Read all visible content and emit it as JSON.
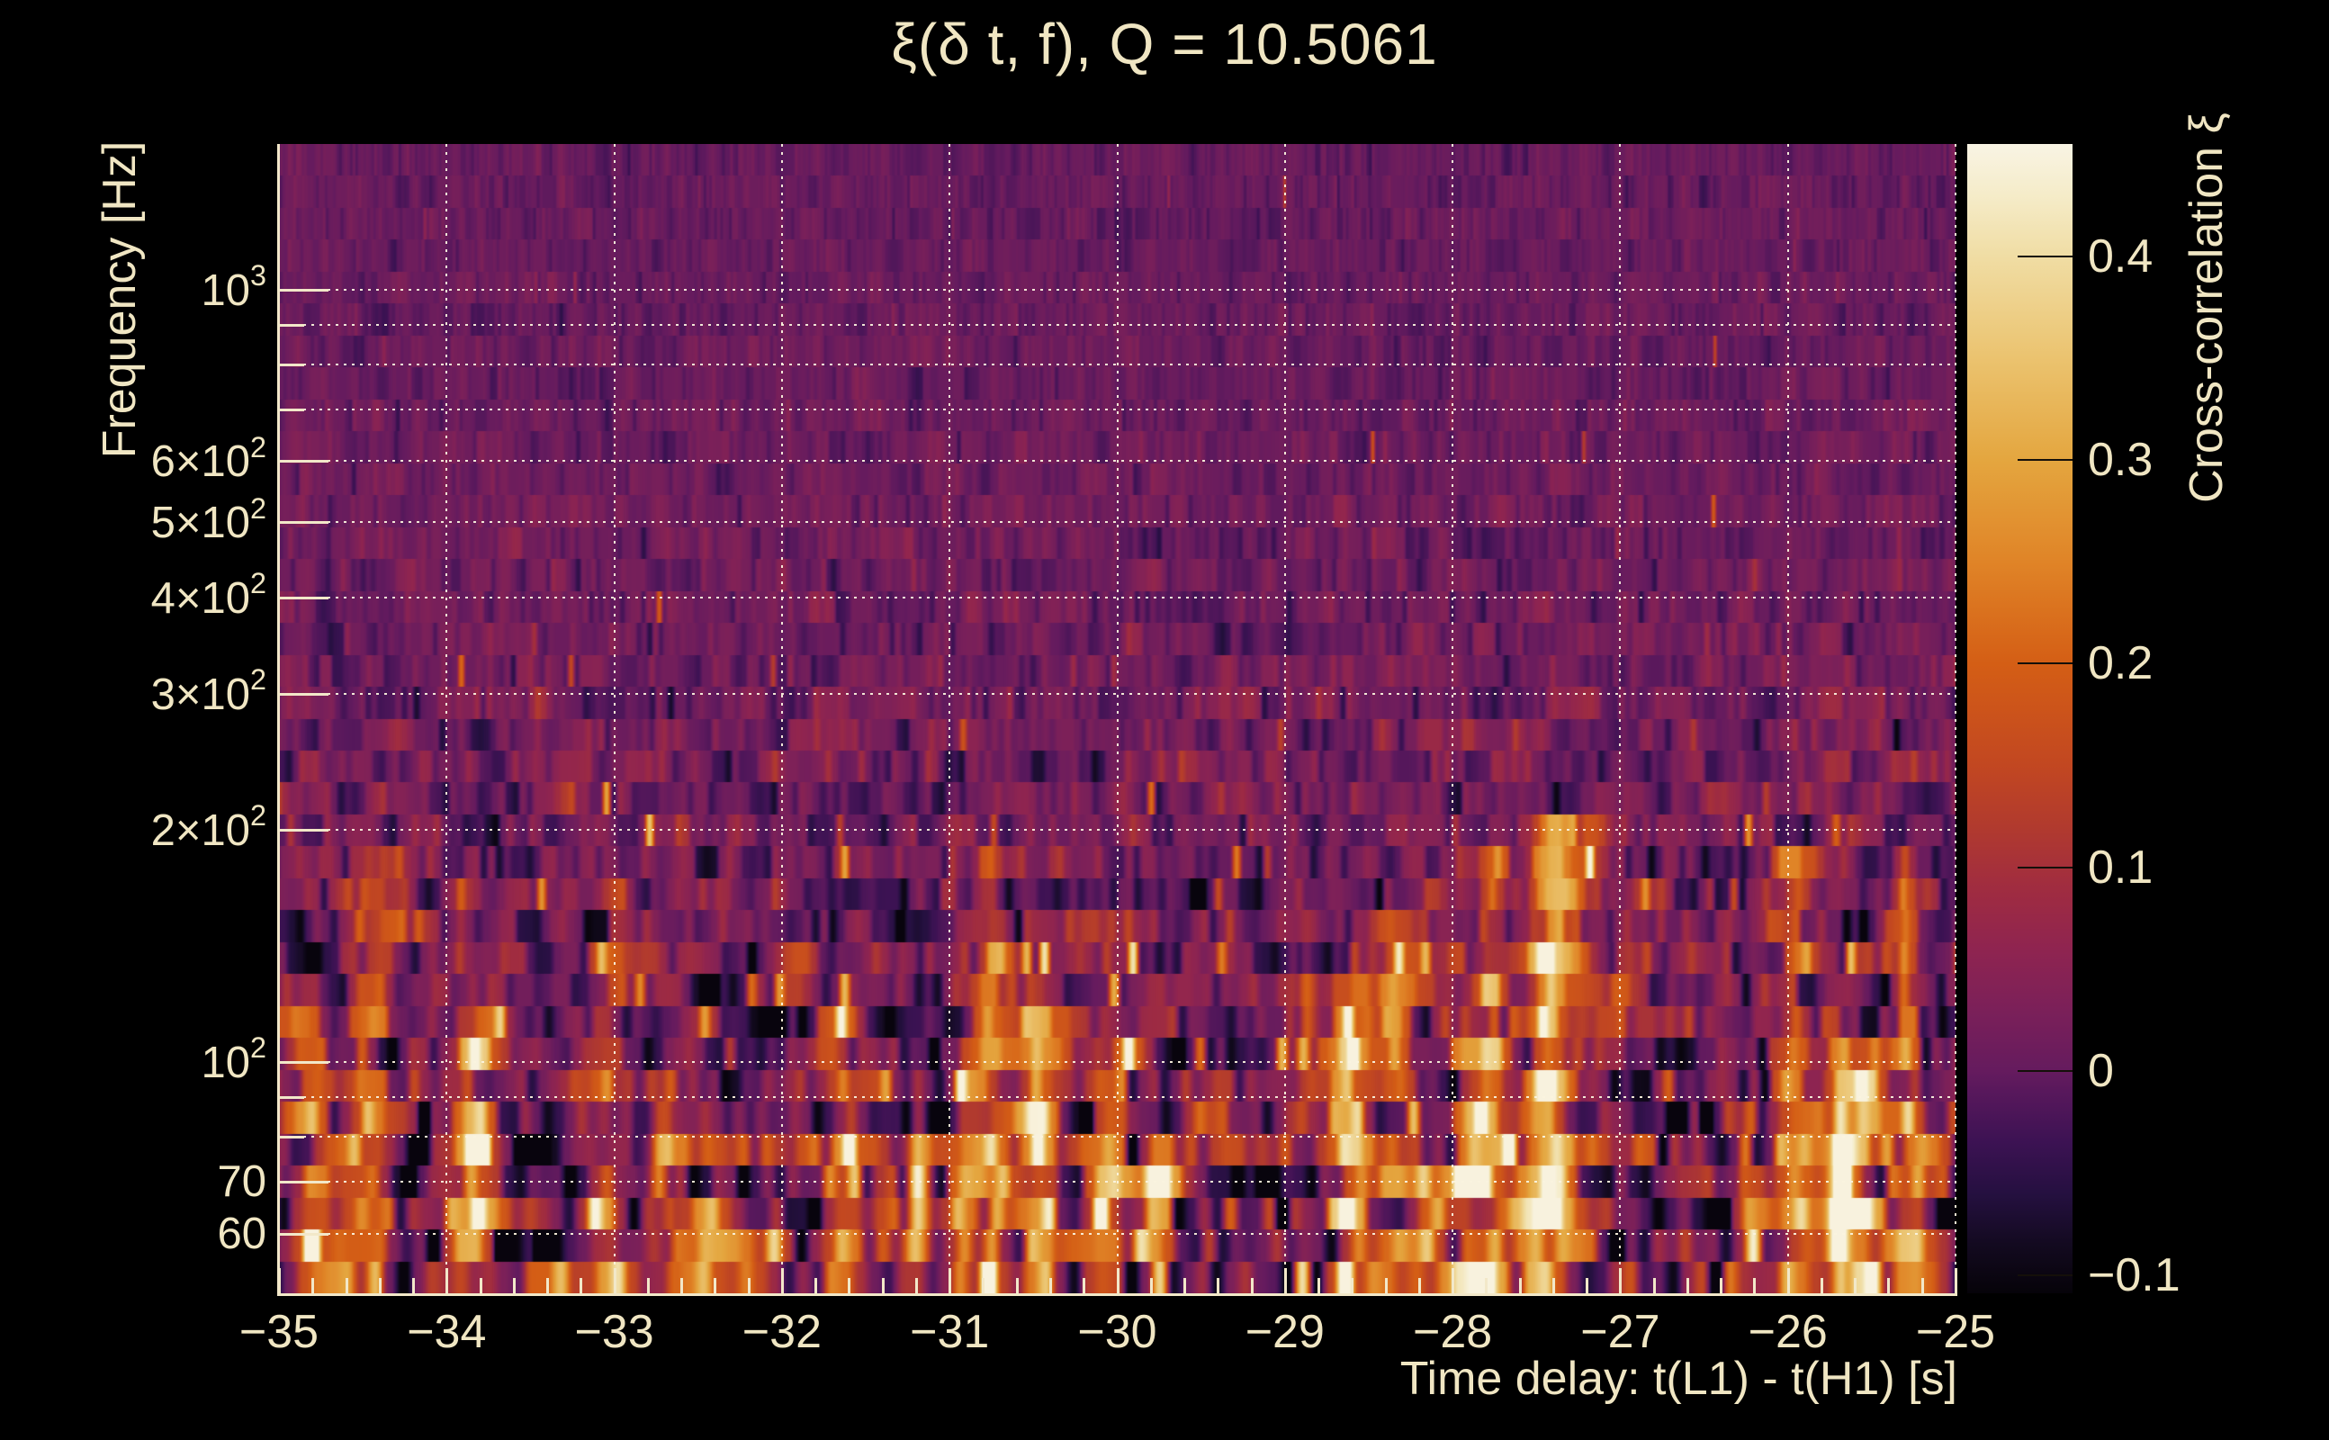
{
  "chart_data": {
    "type": "heatmap",
    "title": "ξ(δ t, f), Q = 10.5061",
    "q_value": 10.5061,
    "xlabel": "Time delay: t(L1) - t(H1) [s]",
    "ylabel": "Frequency [Hz]",
    "colorbar_label": "Cross-correlation ξ",
    "x_range": [
      -35,
      -25
    ],
    "x_minor_step": 0.2,
    "y_scale": "log",
    "y_range_hz": [
      50.2,
      1545
    ],
    "value_range": [
      -0.109,
      0.455
    ],
    "x_ticks": [
      {
        "v": -35,
        "label": "−35"
      },
      {
        "v": -34,
        "label": "−34"
      },
      {
        "v": -33,
        "label": "−33"
      },
      {
        "v": -32,
        "label": "−32"
      },
      {
        "v": -31,
        "label": "−31"
      },
      {
        "v": -30,
        "label": "−30"
      },
      {
        "v": -29,
        "label": "−29"
      },
      {
        "v": -28,
        "label": "−28"
      },
      {
        "v": -27,
        "label": "−27"
      },
      {
        "v": -26,
        "label": "−26"
      },
      {
        "v": -25,
        "label": "−25"
      }
    ],
    "y_ticks": [
      {
        "v": 1000,
        "base": "10",
        "exp": "3"
      },
      {
        "v": 600,
        "base": "6×10",
        "exp": "2"
      },
      {
        "v": 500,
        "base": "5×10",
        "exp": "2"
      },
      {
        "v": 400,
        "base": "4×10",
        "exp": "2"
      },
      {
        "v": 300,
        "base": "3×10",
        "exp": "2"
      },
      {
        "v": 200,
        "base": "2×10",
        "exp": "2"
      },
      {
        "v": 100,
        "base": "10",
        "exp": "2"
      },
      {
        "v": 70,
        "base": "70",
        "exp": ""
      },
      {
        "v": 60,
        "base": "60",
        "exp": ""
      }
    ],
    "y_minor_ticks": [
      80,
      90,
      700,
      800,
      900
    ],
    "grid_y_hz": [
      60,
      70,
      80,
      90,
      100,
      200,
      300,
      400,
      500,
      600,
      700,
      800,
      900,
      1000
    ],
    "colorbar_ticks": [
      {
        "v": 0.4,
        "label": "0.4"
      },
      {
        "v": 0.3,
        "label": "0.3"
      },
      {
        "v": 0.2,
        "label": "0.2"
      },
      {
        "v": 0.1,
        "label": "0.1"
      },
      {
        "v": 0,
        "label": "0"
      },
      {
        "v": -0.1,
        "label": "−0.1"
      }
    ],
    "colormap_stops": [
      [
        -0.109,
        "#060309"
      ],
      [
        -0.085,
        "#130a20"
      ],
      [
        -0.06,
        "#251040"
      ],
      [
        -0.035,
        "#3c1253"
      ],
      [
        -0.01,
        "#58185c"
      ],
      [
        0.0,
        "#651b5e"
      ],
      [
        0.03,
        "#7b2059"
      ],
      [
        0.06,
        "#8f2450"
      ],
      [
        0.09,
        "#a02c40"
      ],
      [
        0.12,
        "#b13a2e"
      ],
      [
        0.15,
        "#c24721"
      ],
      [
        0.2,
        "#d45e15"
      ],
      [
        0.25,
        "#e08427"
      ],
      [
        0.3,
        "#e4a63f"
      ],
      [
        0.35,
        "#ebc36f"
      ],
      [
        0.4,
        "#f0dda4"
      ],
      [
        0.43,
        "#f5ecc9"
      ],
      [
        0.455,
        "#f9f4e4"
      ]
    ],
    "noise_seed": 20151226,
    "n_freq_rows": 36,
    "hot_columns": 46,
    "bright_streaks": [
      {
        "t": -31.19,
        "f": 68,
        "w": 9,
        "peak": 0.46
      },
      {
        "t": -25.7,
        "f": 63,
        "w": 8,
        "peak": 0.44
      },
      {
        "t": -32.72,
        "f": 75,
        "w": 10,
        "peak": 0.3
      },
      {
        "t": -28.87,
        "f": 118,
        "w": 7,
        "peak": 0.2
      }
    ]
  },
  "colors": {
    "background": "#000000",
    "text": "#f0e6c3",
    "grid": "#faf3de",
    "axis": "#f2e8c9",
    "colorbar_tick": "#15100a"
  }
}
